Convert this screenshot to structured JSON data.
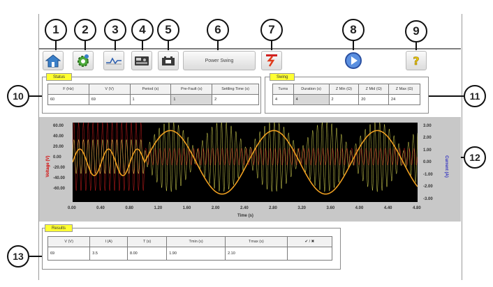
{
  "callouts": [
    "1",
    "2",
    "3",
    "4",
    "5",
    "6",
    "7",
    "8",
    "9",
    "10",
    "11",
    "12",
    "13"
  ],
  "toolbar": {
    "power_swing_label": "Power Swing",
    "icons": [
      "home-icon",
      "settings-gear-icon",
      "waveform-icon",
      "device-icon",
      "battery-icon",
      "power-swing-icon",
      "play-icon",
      "help-icon"
    ]
  },
  "status": {
    "title": "Status",
    "headers": [
      "F (Hz)",
      "V (V)",
      "Period (s)",
      "Pre-Fault (s)",
      "Settling Time (s)"
    ],
    "values": [
      "60",
      "69",
      "1",
      "1",
      "2"
    ]
  },
  "swing": {
    "title": "Swing",
    "headers": [
      "Turns",
      "Duration (s)",
      "Z Min (Ω)",
      "Z Mid (Ω)",
      "Z Max (Ω)"
    ],
    "values": [
      "4",
      "4",
      "2",
      "20",
      "24"
    ]
  },
  "chart_data": {
    "type": "line",
    "xlabel": "Time (s)",
    "ylabel_left": "Voltage (V)",
    "ylabel_right": "Current (A)",
    "xlim": [
      0,
      4.8
    ],
    "ylim_left": [
      -80,
      60
    ],
    "ylim_right": [
      -3.0,
      3.0
    ],
    "x_ticks": [
      "0.00",
      "0.40",
      "0.80",
      "1.20",
      "1.60",
      "2.00",
      "2.40",
      "2.80",
      "3.20",
      "3.60",
      "4.00",
      "4.40",
      "4.80"
    ],
    "y_ticks_left": [
      "60.00",
      "40.00",
      "20.00",
      "0.00",
      "-20.00",
      "-40.00",
      "-60.00"
    ],
    "y_ticks_right": [
      "3.00",
      "2.00",
      "1.00",
      "0.00",
      "-1.00",
      "-2.00",
      "-3.00"
    ],
    "series": [
      {
        "color": "#e02020",
        "prefault_amplitude_V": 60,
        "swing_amplitude_V": 60
      },
      {
        "color": "#f0ef5c",
        "prefault_amplitude_V": 30,
        "swing_amplitude_V": 62,
        "swing_period_s": 0.72
      },
      {
        "color": "#f0a020",
        "prefault_amplitude_A": 1.0,
        "swing_amplitude_A": 2.4,
        "swing_period_s": 0.72
      }
    ],
    "fault_start_s": 1.0
  },
  "results": {
    "title": "Results",
    "headers": [
      "V (V)",
      "I (A)",
      "T (s)",
      "Tmin (s)",
      "Tmax (s)",
      "✔ / ✖"
    ],
    "values": [
      "69",
      "3.5",
      "8.00",
      "1.90",
      "2.10",
      ""
    ]
  },
  "colors": {
    "title_bg": "#ffff33",
    "plot_bg": "#000000",
    "panel_border": "#8c8c8c"
  }
}
